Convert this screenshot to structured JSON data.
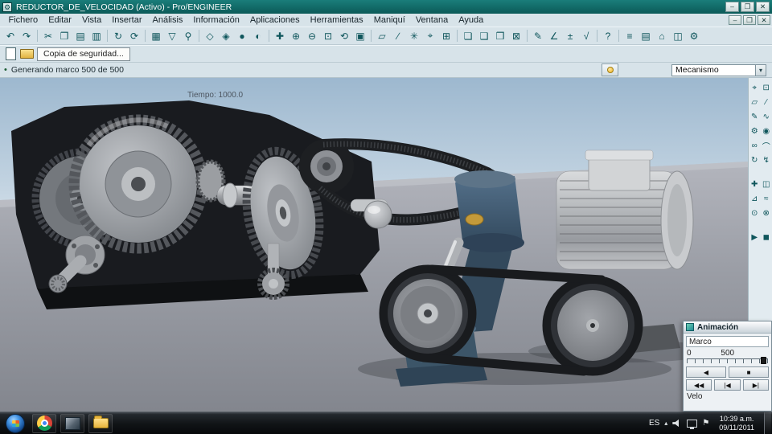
{
  "colors": {
    "titlebar": "#1a7d7a",
    "chrome_bg": "#d7e3e9",
    "accent": "#0f565c",
    "taskbar": "#101316",
    "viewport_sky": "#a3bcd2",
    "table_gray": "#9b9ea6",
    "bearing_blue": "#3a576d",
    "brass": "#c49a3a"
  },
  "window": {
    "title": "REDUCTOR_DE_VELOCIDAD (Activo) - Pro/ENGINEER"
  },
  "win_buttons": {
    "items": [
      {
        "name": "minimize-button",
        "glyph": "–"
      },
      {
        "name": "restore-button",
        "glyph": "❐"
      },
      {
        "name": "close-button",
        "glyph": "✕"
      }
    ]
  },
  "menu": {
    "items": [
      {
        "name": "menu-fichero",
        "label": "Fichero"
      },
      {
        "name": "menu-editar",
        "label": "Editar"
      },
      {
        "name": "menu-vista",
        "label": "Vista"
      },
      {
        "name": "menu-insertar",
        "label": "Insertar"
      },
      {
        "name": "menu-analisis",
        "label": "Análisis"
      },
      {
        "name": "menu-informacion",
        "label": "Información"
      },
      {
        "name": "menu-aplicaciones",
        "label": "Aplicaciones"
      },
      {
        "name": "menu-herramientas",
        "label": "Herramientas"
      },
      {
        "name": "menu-maniqui",
        "label": "Maniquí"
      },
      {
        "name": "menu-ventana",
        "label": "Ventana"
      },
      {
        "name": "menu-ayuda",
        "label": "Ayuda"
      }
    ]
  },
  "toolbar_main": {
    "items": [
      {
        "name": "undo-icon",
        "glyph": "↶"
      },
      {
        "name": "redo-icon",
        "glyph": "↷"
      },
      {
        "sep": true
      },
      {
        "name": "cut-icon",
        "glyph": "✂"
      },
      {
        "name": "copy-icon",
        "glyph": "❐"
      },
      {
        "name": "paste-icon",
        "glyph": "▤"
      },
      {
        "name": "paste-special-icon",
        "glyph": "▥"
      },
      {
        "sep": true
      },
      {
        "name": "regenerate-icon",
        "glyph": "↻"
      },
      {
        "name": "regen-manager-icon",
        "glyph": "⟳"
      },
      {
        "sep": true
      },
      {
        "name": "select-items-icon",
        "glyph": "▦"
      },
      {
        "name": "filter-icon",
        "glyph": "▽"
      },
      {
        "name": "find-icon",
        "glyph": "⚲"
      },
      {
        "sep": true
      },
      {
        "name": "wireframe-icon",
        "glyph": "◇"
      },
      {
        "name": "hidden-line-icon",
        "glyph": "◈"
      },
      {
        "name": "shaded-icon",
        "glyph": "●"
      },
      {
        "name": "enhanced-shaded-icon",
        "glyph": "◐"
      },
      {
        "sep": true
      },
      {
        "name": "spin-center-icon",
        "glyph": "✚"
      },
      {
        "name": "zoom-in-icon",
        "glyph": "⊕"
      },
      {
        "name": "zoom-out-icon",
        "glyph": "⊖"
      },
      {
        "name": "refit-icon",
        "glyph": "⊡"
      },
      {
        "name": "reorient-icon",
        "glyph": "⟲"
      },
      {
        "name": "repaint-icon",
        "glyph": "▣"
      },
      {
        "sep": true
      },
      {
        "name": "datum-plane-toggle-icon",
        "glyph": "▱"
      },
      {
        "name": "datum-axis-toggle-icon",
        "glyph": "∕"
      },
      {
        "name": "datum-point-toggle-icon",
        "glyph": "✳"
      },
      {
        "name": "datum-csys-toggle-icon",
        "glyph": "⌖"
      },
      {
        "name": "print-icon",
        "glyph": "⊞"
      },
      {
        "sep": true
      },
      {
        "name": "new-window-icon",
        "glyph": "❏"
      },
      {
        "name": "window-tile-icon",
        "glyph": "❑"
      },
      {
        "name": "window-cascade-icon",
        "glyph": "❒"
      },
      {
        "name": "close-window-icon",
        "glyph": "⊠"
      },
      {
        "sep": true
      },
      {
        "name": "annotate-icon",
        "glyph": "✎"
      },
      {
        "name": "dimension-icon",
        "glyph": "∠"
      },
      {
        "name": "tolerance-icon",
        "glyph": "±"
      },
      {
        "name": "surface-finish-icon",
        "glyph": "√"
      },
      {
        "sep": true
      },
      {
        "name": "context-help-icon",
        "glyph": "?"
      },
      {
        "sep": true
      },
      {
        "name": "model-tree-icon",
        "glyph": "≡"
      },
      {
        "name": "layer-tree-icon",
        "glyph": "▤"
      },
      {
        "name": "saved-views-icon",
        "glyph": "⌂"
      },
      {
        "name": "view-manager-icon",
        "glyph": "◫"
      },
      {
        "name": "settings-icon",
        "glyph": "⚙"
      }
    ]
  },
  "toolbar_file": {
    "items": [
      {
        "name": "new-file-icon",
        "glyph": ""
      },
      {
        "name": "open-file-icon",
        "glyph": ""
      }
    ],
    "tooltip": "Copia de seguridad..."
  },
  "statusbar": {
    "bullet": "•",
    "message": "Generando marco 500 de 500",
    "combo_value": "Mecanismo",
    "combo_arrow": "▾"
  },
  "viewport": {
    "time_label": "Tiempo: 1000.0"
  },
  "right_toolbar": {
    "items": [
      {
        "name": "mech-select-icon",
        "glyph": "⌖"
      },
      {
        "name": "mech-refit-icon",
        "glyph": "⊡"
      },
      {
        "name": "mech-plane-icon",
        "glyph": "▱"
      },
      {
        "name": "mech-axis-icon",
        "glyph": "∕"
      },
      {
        "name": "mech-sketch-icon",
        "glyph": "✎"
      },
      {
        "name": "mech-spring-icon",
        "glyph": "∿"
      },
      {
        "name": "mech-gear-icon",
        "glyph": "⚙"
      },
      {
        "name": "mech-cam-icon",
        "glyph": "◉"
      },
      {
        "name": "mech-belt-icon",
        "glyph": "∞"
      },
      {
        "name": "mech-slot-icon",
        "glyph": "⌒"
      },
      {
        "name": "mech-servo-motor-icon",
        "glyph": "↻"
      },
      {
        "name": "mech-force-icon",
        "glyph": "↯"
      },
      {
        "sep": true
      },
      {
        "name": "mech-drag-icon",
        "glyph": "✚"
      },
      {
        "name": "mech-snapshot-icon",
        "glyph": "◫"
      },
      {
        "name": "mech-measure-icon",
        "glyph": "⊿"
      },
      {
        "name": "mech-trace-icon",
        "glyph": "≈"
      },
      {
        "name": "mech-mass-icon",
        "glyph": "⊙"
      },
      {
        "name": "mech-interference-icon",
        "glyph": "⊗"
      },
      {
        "sep": true
      },
      {
        "name": "mech-playback-icon",
        "glyph": "▶"
      },
      {
        "name": "mech-capture-icon",
        "glyph": "◼"
      }
    ]
  },
  "animation": {
    "title": "Animación",
    "frame_label": "Marco",
    "scale_start": "0",
    "scale_mid": "500",
    "buttons": [
      {
        "name": "play-reverse-button",
        "glyph": "◀"
      },
      {
        "name": "stop-button",
        "glyph": "■"
      }
    ],
    "buttons2": [
      {
        "name": "rewind-button",
        "glyph": "◀◀"
      },
      {
        "name": "go-start-button",
        "glyph": "|◀"
      },
      {
        "name": "go-end-button",
        "glyph": "▶|"
      }
    ],
    "velocity_label": "Velo"
  },
  "taskbar": {
    "tray": {
      "lang": "ES",
      "hidden_arrow": "▴",
      "time": "10:39 a.m.",
      "date": "09/11/2011"
    }
  }
}
